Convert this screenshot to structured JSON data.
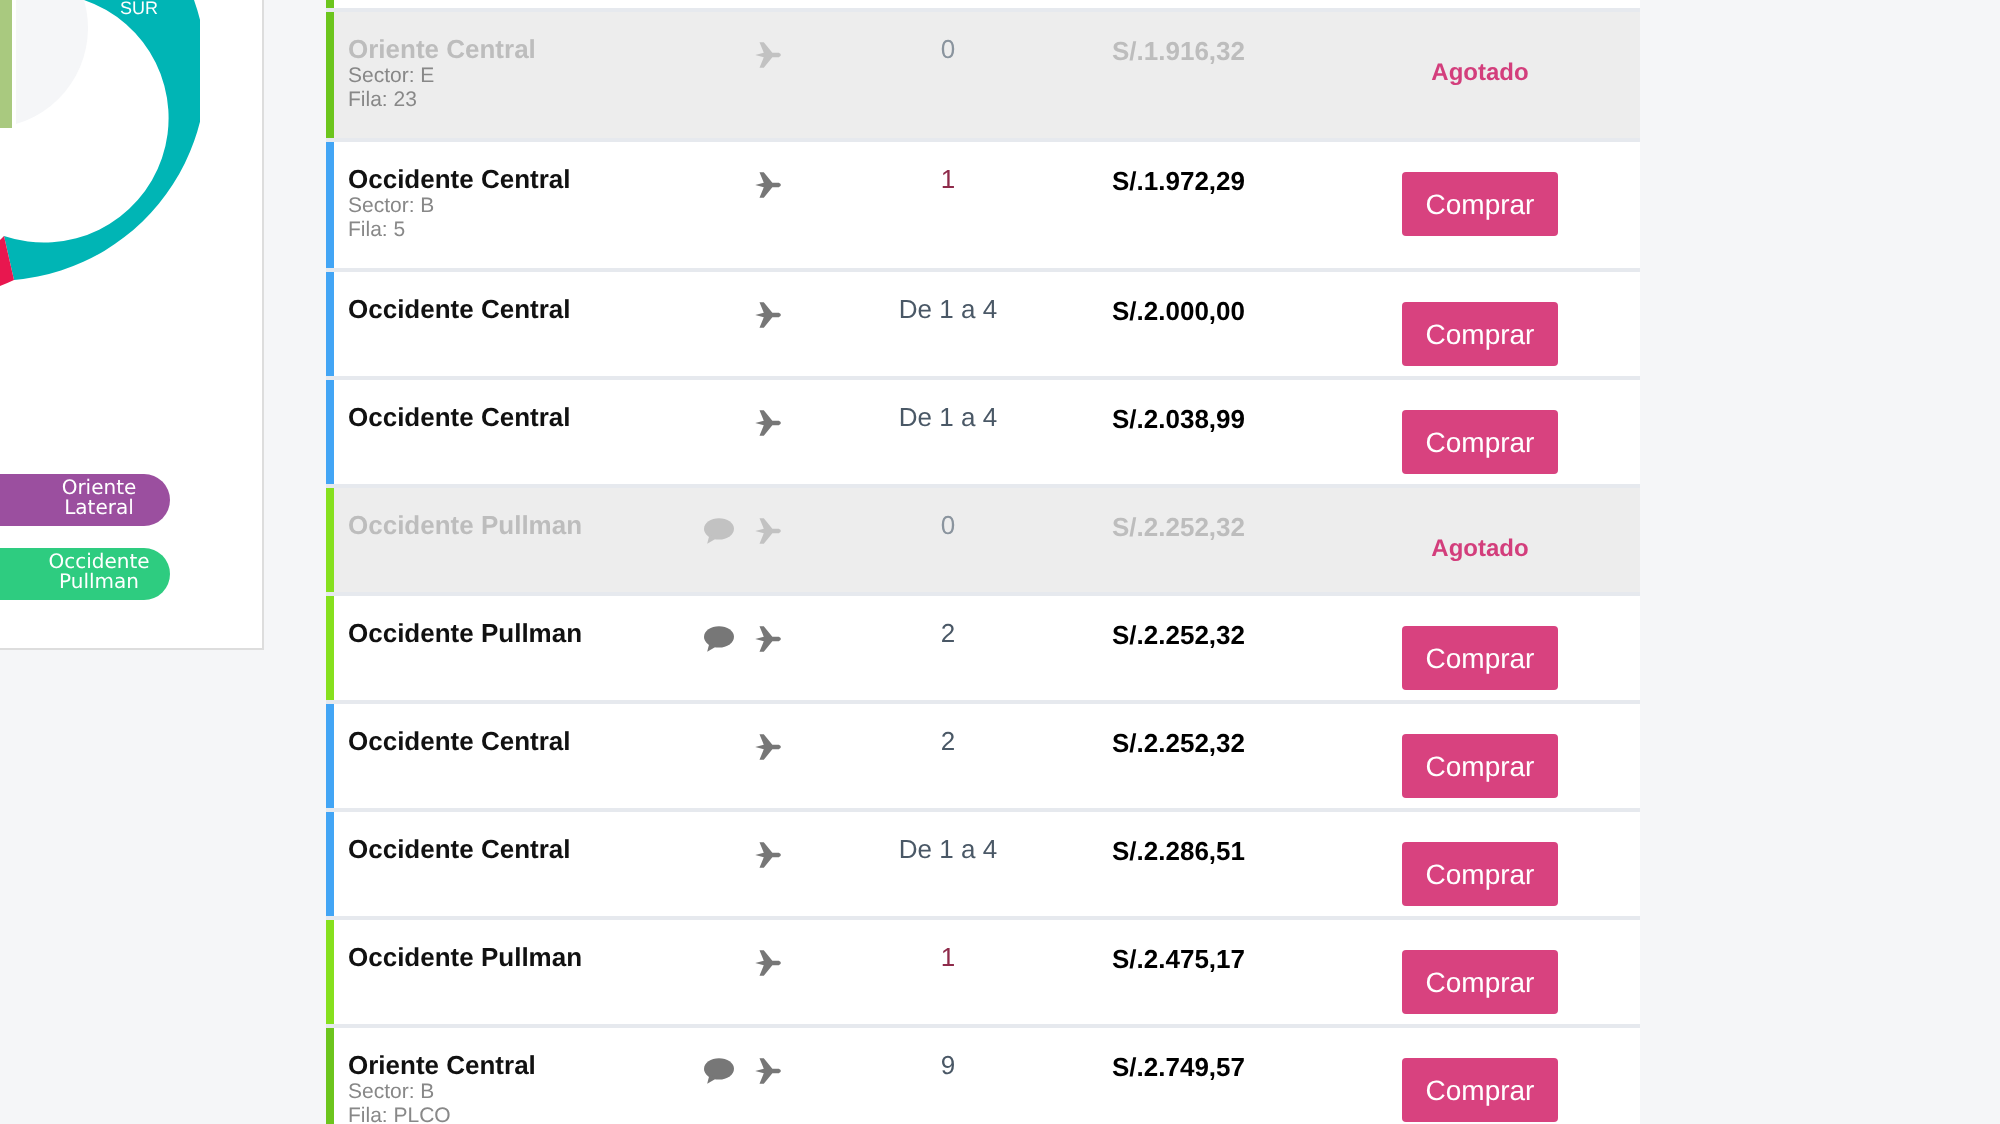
{
  "chart": {
    "label": "SUR"
  },
  "legend": [
    {
      "label": "Oriente Lateral",
      "color": "#9b4f9f"
    },
    {
      "label": "Occidente Pullman",
      "color": "#2ecc80"
    }
  ],
  "rows": [
    {
      "kind": "clipped",
      "color": "#6cc51d"
    },
    {
      "kind": "ticket",
      "zone": "Oriente Central",
      "sector": "Sector: E",
      "fila": "Fila: 23",
      "chat": false,
      "quantity": "0",
      "quantity_alert": false,
      "price": "S/.1.916,32",
      "sold_out": true,
      "status": "Agotado",
      "color": "#6cc51d"
    },
    {
      "kind": "ticket",
      "zone": "Occidente Central",
      "sector": "Sector: B",
      "fila": "Fila: 5",
      "chat": false,
      "quantity": "1",
      "quantity_alert": true,
      "price": "S/.1.972,29",
      "sold_out": false,
      "action": "Comprar",
      "color": "#42a5f5"
    },
    {
      "kind": "ticket",
      "zone": "Occidente Central",
      "chat": false,
      "quantity": "De 1 a 4",
      "quantity_alert": false,
      "price": "S/.2.000,00",
      "sold_out": false,
      "action": "Comprar",
      "color": "#42a5f5"
    },
    {
      "kind": "ticket",
      "zone": "Occidente Central",
      "chat": false,
      "quantity": "De 1 a 4",
      "quantity_alert": false,
      "price": "S/.2.038,99",
      "sold_out": false,
      "action": "Comprar",
      "color": "#42a5f5"
    },
    {
      "kind": "ticket",
      "zone": "Occidente Pullman",
      "chat": true,
      "quantity": "0",
      "quantity_alert": false,
      "price": "S/.2.252,32",
      "sold_out": true,
      "status": "Agotado",
      "color": "#86e01e"
    },
    {
      "kind": "ticket",
      "zone": "Occidente Pullman",
      "chat": true,
      "quantity": "2",
      "quantity_alert": false,
      "price": "S/.2.252,32",
      "sold_out": false,
      "action": "Comprar",
      "color": "#86e01e"
    },
    {
      "kind": "ticket",
      "zone": "Occidente Central",
      "chat": false,
      "quantity": "2",
      "quantity_alert": false,
      "price": "S/.2.252,32",
      "sold_out": false,
      "action": "Comprar",
      "color": "#42a5f5"
    },
    {
      "kind": "ticket",
      "zone": "Occidente Central",
      "chat": false,
      "quantity": "De 1 a 4",
      "quantity_alert": false,
      "price": "S/.2.286,51",
      "sold_out": false,
      "action": "Comprar",
      "color": "#42a5f5"
    },
    {
      "kind": "ticket",
      "zone": "Occidente Pullman",
      "chat": false,
      "quantity": "1",
      "quantity_alert": true,
      "price": "S/.2.475,17",
      "sold_out": false,
      "action": "Comprar",
      "color": "#86e01e"
    },
    {
      "kind": "ticket",
      "zone": "Oriente Central",
      "sector": "Sector: B",
      "fila": "Fila: PLCO",
      "chat": true,
      "quantity": "9",
      "quantity_alert": false,
      "price": "S/.2.749,57",
      "sold_out": false,
      "action": "Comprar",
      "color": "#6cc51d"
    }
  ]
}
